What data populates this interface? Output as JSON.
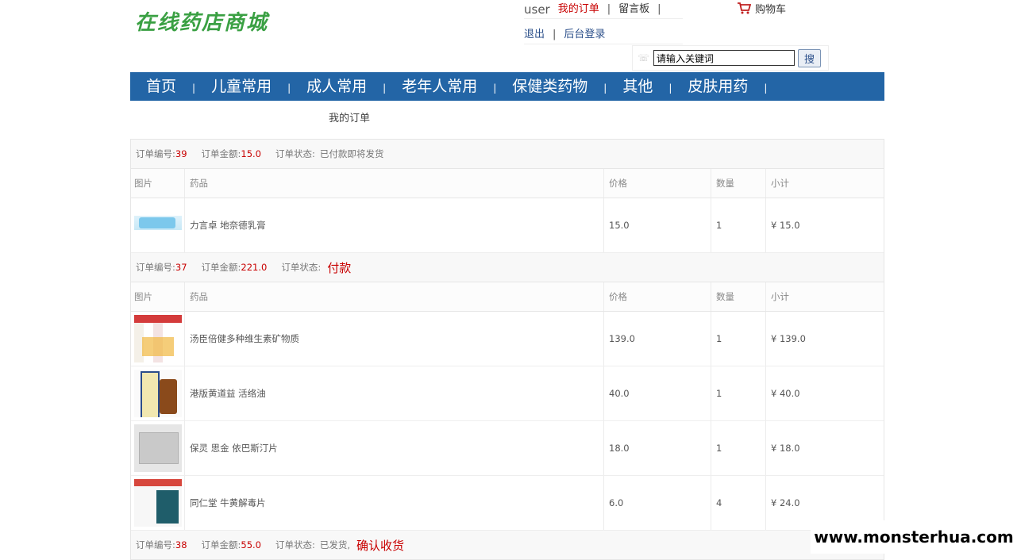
{
  "header": {
    "logo_text": "在线药店商城",
    "user_name": "user",
    "links": {
      "my_orders": "我的订单",
      "message_board": "留言板",
      "logout": "退出",
      "admin_login": "后台登录",
      "separator": "|"
    },
    "cart_label": "购物车"
  },
  "search": {
    "value": "请输入关键词",
    "button_label": "搜"
  },
  "nav": {
    "items": [
      {
        "label": "首页"
      },
      {
        "label": "儿童常用"
      },
      {
        "label": "成人常用"
      },
      {
        "label": "老年人常用"
      },
      {
        "label": "保健类药物"
      },
      {
        "label": "其他"
      },
      {
        "label": "皮肤用药"
      }
    ],
    "separator": "|"
  },
  "breadcrumb": "我的订单",
  "labels": {
    "order_no": "订单编号:",
    "order_amount": "订单金额:",
    "order_status": "订单状态:",
    "col_image": "图片",
    "col_name": "药品",
    "col_price": "价格",
    "col_qty": "数量",
    "col_subtotal": "小计"
  },
  "orders": [
    {
      "id": "39",
      "amount": "15.0",
      "status": "已付款即将发货",
      "action": "",
      "items": [
        {
          "name": "力言卓 地奈德乳膏",
          "price": "15.0",
          "qty": "1",
          "subtotal": "¥ 15.0",
          "image_icon": "cream-tube-image"
        }
      ]
    },
    {
      "id": "37",
      "amount": "221.0",
      "status": "",
      "action": "付款",
      "items": [
        {
          "name": "汤臣倍健多种维生素矿物质",
          "price": "139.0",
          "qty": "1",
          "subtotal": "¥ 139.0",
          "image_icon": "vitamin-bottles-image"
        },
        {
          "name": "港版黄道益 活络油",
          "price": "40.0",
          "qty": "1",
          "subtotal": "¥ 40.0",
          "image_icon": "oil-bottle-image"
        },
        {
          "name": "保灵 思金 依巴斯汀片",
          "price": "18.0",
          "qty": "1",
          "subtotal": "¥ 18.0",
          "image_icon": "tablet-packet-image"
        },
        {
          "name": "同仁堂 牛黄解毒片",
          "price": "6.0",
          "qty": "4",
          "subtotal": "¥ 24.0",
          "image_icon": "medicine-box-image"
        }
      ]
    },
    {
      "id": "38",
      "amount": "55.0",
      "status": "已发货,",
      "action": "确认收货",
      "items": []
    }
  ],
  "watermark": "www.monsterhua.com",
  "colors": {
    "nav_bg": "#2365a6",
    "accent_red": "#c80000",
    "logo_green": "#3aa043"
  }
}
